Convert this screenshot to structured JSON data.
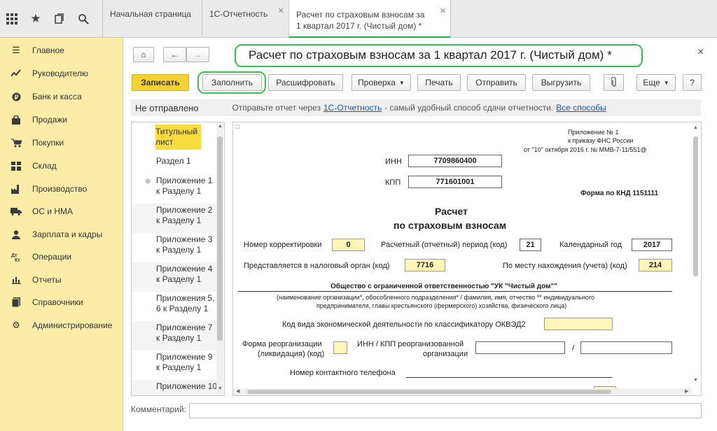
{
  "top": {
    "icons": [
      "grid-icon",
      "star-icon",
      "history-icon",
      "search-icon"
    ],
    "tabs": [
      {
        "label": "Начальная страница"
      },
      {
        "label": "1С-Отчетность"
      },
      {
        "label_line1": "Расчет по страховым взносам за",
        "label_line2": "1 квартал 2017 г. (Чистый дом) *"
      }
    ]
  },
  "sidebar": {
    "items": [
      {
        "label": "Главное",
        "icon": "menu-icon"
      },
      {
        "label": "Руководителю",
        "icon": "trend-icon"
      },
      {
        "label": "Банк и касса",
        "icon": "coin-icon"
      },
      {
        "label": "Продажи",
        "icon": "bag-icon"
      },
      {
        "label": "Покупки",
        "icon": "cart-icon"
      },
      {
        "label": "Склад",
        "icon": "warehouse-icon"
      },
      {
        "label": "Производство",
        "icon": "factory-icon"
      },
      {
        "label": "ОС и НМА",
        "icon": "truck-icon"
      },
      {
        "label": "Зарплата и кадры",
        "icon": "person-icon"
      },
      {
        "label": "Операции",
        "icon": "operations-icon"
      },
      {
        "label": "Отчеты",
        "icon": "bar-chart-icon"
      },
      {
        "label": "Справочники",
        "icon": "book-icon"
      },
      {
        "label": "Администрирование",
        "icon": "gear-icon"
      }
    ]
  },
  "window": {
    "title": "Расчет по страховым взносам за 1 квартал 2017 г. (Чистый дом) *",
    "close": "×"
  },
  "toolbar": {
    "save": "Записать",
    "fill": "Заполнить",
    "decode": "Расшифровать",
    "check": "Проверка",
    "print": "Печать",
    "send": "Отправить",
    "export": "Выгрузить",
    "more": "Еще",
    "help": "?"
  },
  "status": {
    "state": "Не отправлено",
    "hint_pre": "Отправьте отчет через",
    "hint_link": "1С-Отчетность",
    "hint_post": "- самый удобный способ сдачи отчетности.",
    "all_ways": "Все способы"
  },
  "nav": {
    "items": [
      {
        "l1": "Титульный",
        "l2": "лист"
      },
      {
        "l1": "Раздел 1",
        "l2": ""
      },
      {
        "l1": "Приложение 1",
        "l2": "к Разделу 1"
      },
      {
        "l1": "Приложение 2",
        "l2": "к Разделу 1"
      },
      {
        "l1": "Приложение 3",
        "l2": "к Разделу 1"
      },
      {
        "l1": "Приложение 4",
        "l2": "к Разделу 1"
      },
      {
        "l1": "Приложения 5,",
        "l2": "6 к Разделу 1"
      },
      {
        "l1": "Приложение 7",
        "l2": "к Разделу 1"
      },
      {
        "l1": "Приложение 9",
        "l2": "к Разделу 1"
      },
      {
        "l1": "Приложение 10",
        "l2": ""
      }
    ]
  },
  "form": {
    "appendix1": "Приложение № 1",
    "appendix2": "к приказу ФНС России",
    "appendix3": "от \"10\" октября 2016 г. № ММВ-7-11/551@",
    "inn_label": "ИНН",
    "inn": "7709860400",
    "kpp_label": "КПП",
    "kpp": "771601001",
    "knd": "Форма по КНД 1151111",
    "heading1": "Расчет",
    "heading2": "по страховым взносам",
    "corr_label": "Номер корректировки",
    "corr": "0",
    "period_label": "Расчетный (отчетный) период (код)",
    "period": "21",
    "year_label": "Календарный год",
    "year": "2017",
    "tax_label": "Представляется в налоговый орган (код)",
    "tax": "7716",
    "place_label": "По месту нахождения (учета) (код)",
    "place": "214",
    "org": "Общество с ограниченной ответственностью \"УК \"Чистый дом\"\"",
    "org_hint1": "(наименование организации*, обособленного подразделения* / фамилия, имя, отчество ** индивидуального",
    "org_hint2": "предпринимателя, главы крестьянского (фермерского) хозяйства, физического лица)",
    "okved_label": "Код вида экономической деятельности по классификатору ОКВЭД2",
    "reorg_label1": "Форма реорганизации",
    "reorg_label2": "(ликвидация) (код)",
    "reorg_inn_label1": "ИНН / КПП реорганизованной",
    "reorg_inn_label2": "организации",
    "slash": "/",
    "phone_label": "Номер контактного телефона"
  },
  "comment": {
    "label": "Комментарий:"
  }
}
